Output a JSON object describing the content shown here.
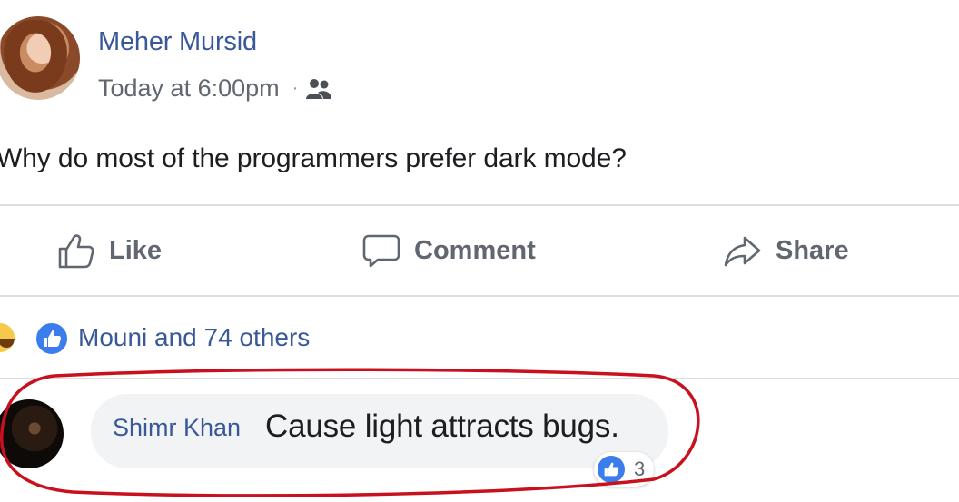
{
  "post": {
    "author_name": "Meher Mursid",
    "timestamp": "Today at 6:00pm",
    "separator": "·",
    "audience_icon": "friends-icon",
    "text": "Why do most of the programmers prefer dark mode?"
  },
  "actions": {
    "like_label": "Like",
    "comment_label": "Comment",
    "share_label": "Share"
  },
  "reactions": {
    "icons": [
      "haha-icon",
      "like-icon"
    ],
    "summary": "Mouni and 74 others"
  },
  "comment": {
    "author_name": "Shimr Khan",
    "text": "Cause light attracts bugs.",
    "like_count": "3"
  },
  "colors": {
    "link_blue": "#385898",
    "muted_gray": "#606770",
    "like_blue": "#3b7ded",
    "bubble_bg": "#f2f3f5",
    "annotation_red": "#c8101e"
  }
}
